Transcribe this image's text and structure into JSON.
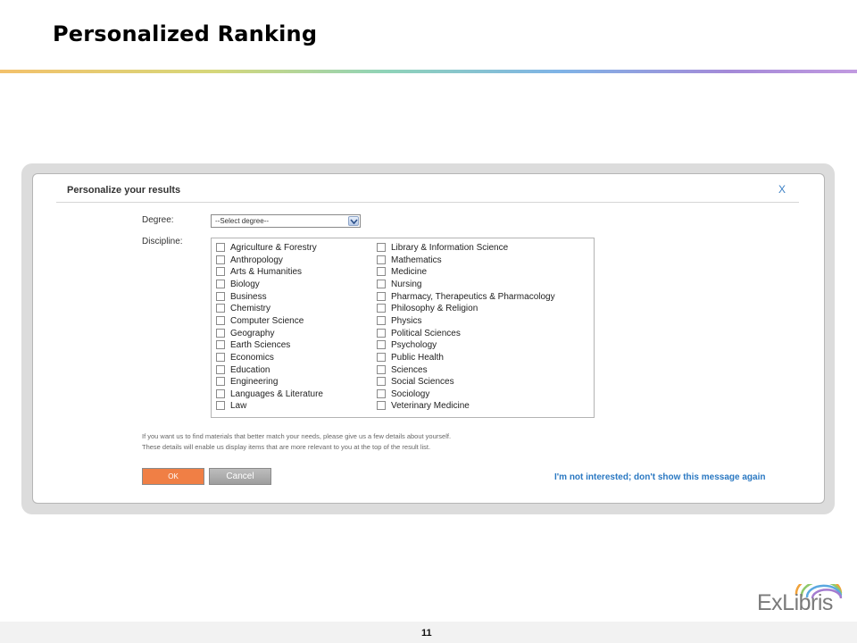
{
  "slide": {
    "title": "Personalized Ranking",
    "page_number": "11"
  },
  "dialog": {
    "title": "Personalize your results",
    "close_label": "X",
    "degree_label": "Degree:",
    "degree_value": "--Select degree--",
    "discipline_label": "Discipline:",
    "disciplines_left": [
      "Agriculture & Forestry",
      "Anthropology",
      "Arts & Humanities",
      "Biology",
      "Business",
      "Chemistry",
      "Computer Science",
      "Geography",
      "Earth Sciences",
      "Economics",
      "Education",
      "Engineering",
      "Languages & Literature",
      "Law"
    ],
    "disciplines_right": [
      "Library & Information Science",
      "Mathematics",
      "Medicine",
      "Nursing",
      "Pharmacy, Therapeutics & Pharmacology",
      "Philosophy & Religion",
      "Physics",
      "Political Sciences",
      "Psychology",
      "Public Health",
      "Sciences",
      "Social Sciences",
      "Sociology",
      "Veterinary Medicine"
    ],
    "info_line1": "If you want us to find materials that better match your needs, please give us a few details about yourself.",
    "info_line2": "These details will enable us display items that are more relevant to you at the top of the result list.",
    "ok_label": "OK",
    "cancel_label": "Cancel",
    "not_interested_label": "I'm not interested; don't show this message again"
  },
  "logo": {
    "text": "ExLibris"
  },
  "colors": {
    "ok_button": "#f07f45",
    "link": "#2a78c2",
    "frame": "#dcdcdc"
  }
}
